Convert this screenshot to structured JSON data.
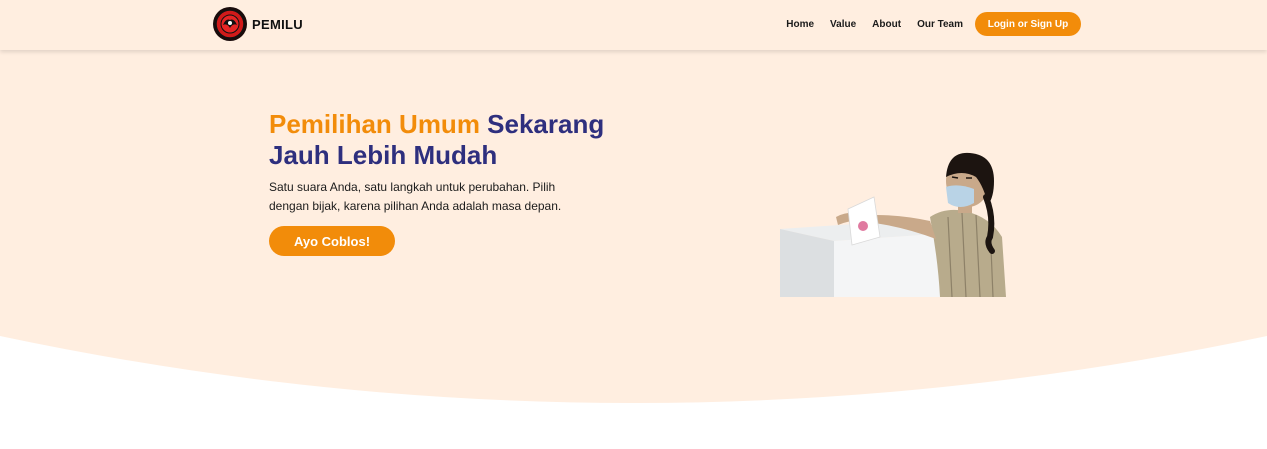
{
  "brand": {
    "name": "PEMILU",
    "logo_icon": "party-emblem-icon"
  },
  "nav": {
    "links": [
      "Home",
      "Value",
      "About",
      "Our Team"
    ],
    "login_label": "Login or Sign Up"
  },
  "hero": {
    "title_accent": "Pemilihan Umum",
    "title_rest": "Sekarang Jauh Lebih Mudah",
    "subtitle": "Satu suara Anda, satu langkah untuk perubahan. Pilih dengan bijak, karena pilihan Anda adalah masa depan.",
    "cta_label": "Ayo Coblos!",
    "image_icon": "voter-ballot-box-illustration"
  },
  "colors": {
    "background": "#ffeee0",
    "accent": "#f28c0a",
    "heading": "#2e2f7e",
    "text": "#1b1b1b"
  }
}
